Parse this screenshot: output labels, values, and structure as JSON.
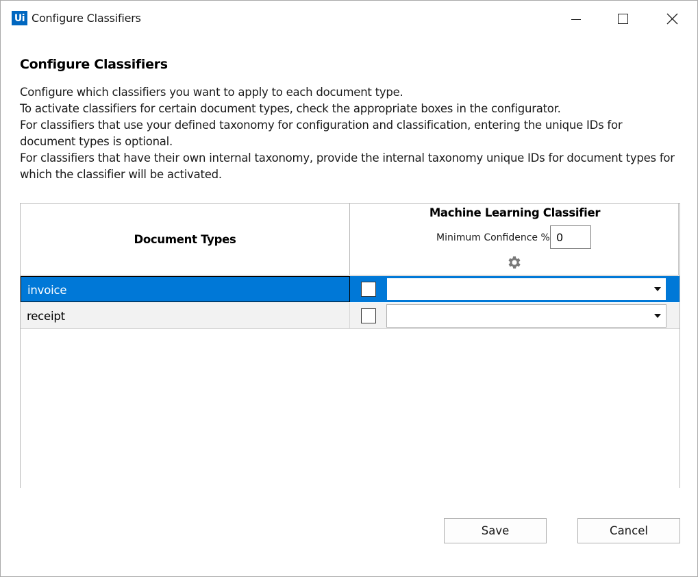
{
  "window": {
    "logo": "Ui",
    "title": "Configure Classifiers",
    "controls": [
      "minimize-icon",
      "maximize-icon",
      "close-icon"
    ]
  },
  "heading": "Configure Classifiers",
  "description": [
    "Configure which classifiers you want to apply to each document type.",
    "To activate classifiers for certain document types, check the appropriate boxes in the configurator.",
    "For classifiers that use your defined taxonomy for configuration and classification, entering the unique IDs for document types is optional.",
    "For classifiers that have their own internal taxonomy, provide the internal taxonomy unique IDs for document types for which the classifier will be activated."
  ],
  "grid": {
    "doc_types_header": "Document Types",
    "classifier_header": "Machine Learning Classifier",
    "min_confidence_label": "Minimum Confidence %",
    "min_confidence_value": "0",
    "settings_icon": "gear-icon",
    "rows": [
      {
        "name": "invoice",
        "checked": false,
        "selected": true,
        "dropdown_value": ""
      },
      {
        "name": "receipt",
        "checked": false,
        "selected": false,
        "dropdown_value": ""
      }
    ]
  },
  "buttons": {
    "save": "Save",
    "cancel": "Cancel"
  },
  "colors": {
    "selection": "#0078d7",
    "logo": "#0067c0"
  }
}
